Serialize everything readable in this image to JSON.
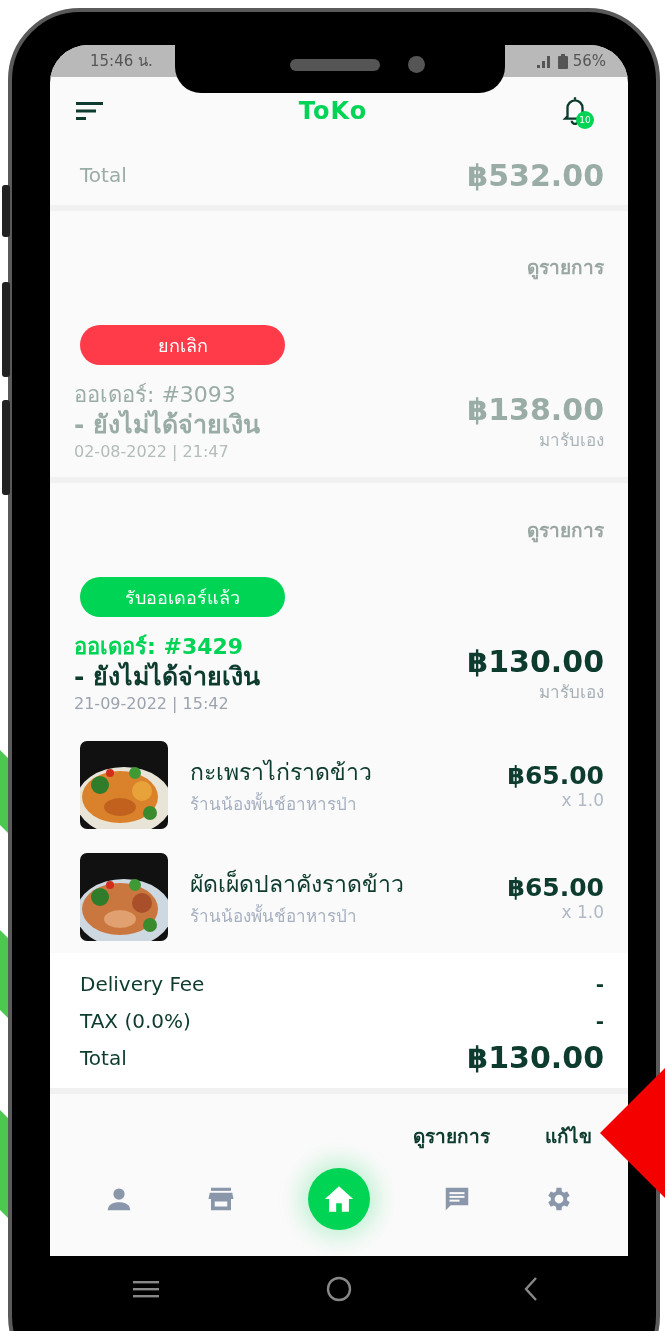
{
  "status_bar": {
    "time": "15:46 น.",
    "battery": "56%"
  },
  "header": {
    "title": "ToKo",
    "notification_count": "10"
  },
  "previous_order": {
    "total_label": "Total",
    "total": "฿532.00",
    "view_link": "ดูรายการ"
  },
  "orders": [
    {
      "kind": "cancelled",
      "status": "ยกเลิก",
      "color": "#ff3b4a",
      "number": "ออเดอร์: #3093",
      "payment": "- ยังไม่ได้จ่ายเงิน",
      "datetime": "02-08-2022 | 21:47",
      "price": "฿138.00",
      "delivery": "มารับเอง",
      "actions": [
        "ดูรายการ"
      ]
    },
    {
      "kind": "accepted",
      "status": "รับออเดอร์แล้ว",
      "color": "#00d455",
      "number": "ออเดอร์: #3429",
      "payment": "- ยังไม่ได้จ่ายเงิน",
      "datetime": "21-09-2022 | 15:42",
      "price": "฿130.00",
      "delivery": "มารับเอง",
      "items": [
        {
          "name": "กะเพราไก่ราดข้าว",
          "shop": "ร้านน้องพั้นช์อาหารป่า",
          "price": "฿65.00",
          "quantity": "x 1.0"
        },
        {
          "name": "ผัดเผ็ดปลาคังราดข้าว",
          "shop": "ร้านน้องพั้นช์อาหารป่า",
          "price": "฿65.00",
          "quantity": "x 1.0"
        }
      ],
      "summary": [
        {
          "label": "Delivery Fee",
          "value": "-"
        },
        {
          "label": "TAX (0.0%)",
          "value": "-"
        },
        {
          "label": "Total",
          "value": "฿130.00"
        }
      ],
      "actions": [
        "ดูรายการ",
        "แก้ไข"
      ]
    }
  ],
  "bottom_nav": [
    {
      "kind": "person",
      "selected": false
    },
    {
      "kind": "store",
      "selected": false
    },
    {
      "kind": "home",
      "selected": true
    },
    {
      "kind": "chat",
      "selected": false
    },
    {
      "kind": "settings",
      "selected": false
    }
  ]
}
